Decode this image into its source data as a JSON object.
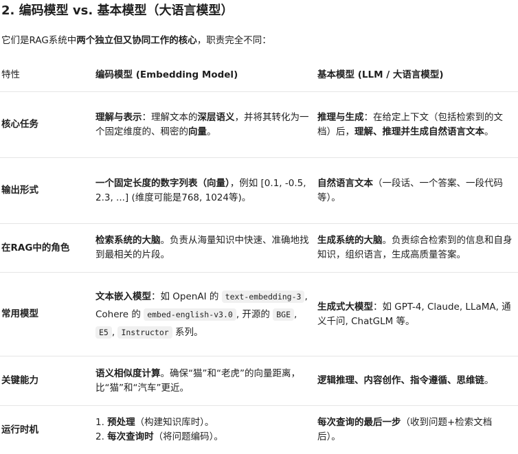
{
  "heading": "2. 编码模型 vs. 基本模型（大语言模型）",
  "intro": {
    "prefix": "它们是RAG系统中",
    "bold": "两个独立但又协同工作的核心",
    "suffix": "，职责完全不同："
  },
  "table": {
    "headers": [
      "特性",
      "编码模型 (Embedding Model)",
      "基本模型 (LLM / 大语言模型)"
    ],
    "rows": [
      {
        "feature": "核心任务",
        "embed": {
          "b1": "理解与表示",
          "t1": "：理解文本的",
          "b2": "深层语义",
          "t2": "，并将其转化为一个固定维度的、稠密的",
          "b3": "向量",
          "t3": "。"
        },
        "llm": {
          "b1": "推理与生成",
          "t1": "：在给定上下文（包括检索到的文档）后，",
          "b2": "理解、推理并生成自然语言文本",
          "t2": "。"
        }
      },
      {
        "feature": "输出形式",
        "embed": {
          "b1": "一个固定长度的数字列表（向量）",
          "t1": "，例如 [0.1, -0.5, 2.3, ...] (维度可能是768, 1024等)。"
        },
        "llm": {
          "b1": "自然语言文本",
          "t1": "（一段话、一个答案、一段代码等）。"
        }
      },
      {
        "feature": "在RAG中的角色",
        "embed": {
          "b1": "检索系统的大脑",
          "t1": "。负责从海量知识中快速、准确地找到最相关的片段。"
        },
        "llm": {
          "b1": "生成系统的大脑",
          "t1": "。负责综合检索到的信息和自身知识，组织语言，生成高质量答案。"
        }
      },
      {
        "feature": "常用模型",
        "embed": {
          "b1": "文本嵌入模型",
          "t1": "：如 OpenAI 的",
          "code1": "text-embedding-3",
          "t2": ", Cohere 的",
          "code2": "embed-english-v3.0",
          "t3": ", 开源的",
          "code3": "BGE",
          "t4": ",",
          "code4": "E5",
          "t5": ",",
          "code5": "Instructor",
          "t6": " 系列。"
        },
        "llm": {
          "b1": "生成式大模型",
          "t1": "：如 GPT-4, Claude, LLaMA, 通义千问, ChatGLM 等。"
        }
      },
      {
        "feature": "关键能力",
        "embed": {
          "b1": "语义相似度计算",
          "t1": "。确保“猫”和“老虎”的向量距离，比“猫”和“汽车”更近。"
        },
        "llm": {
          "b1": "逻辑推理、内容创作、指令遵循、思维链",
          "t1": "。"
        }
      },
      {
        "feature": "运行时机",
        "embed": {
          "l1n": "1. ",
          "l1b": "预处理",
          "l1t": "（构建知识库时）。",
          "l2n": "2. ",
          "l2b": "每次查询时",
          "l2t": "（将问题编码）。"
        },
        "llm": {
          "b1": "每次查询的最后一步",
          "t1": "（收到问题+检索文档后）。"
        }
      }
    ]
  }
}
